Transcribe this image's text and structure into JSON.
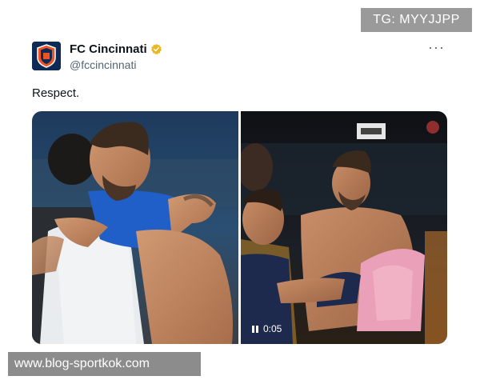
{
  "overlay": {
    "tg_label": "TG: MYYJJPP",
    "watermark": "www.blog-sportkok.com"
  },
  "tweet": {
    "display_name": "FC Cincinnati",
    "handle": "@fccincinnati",
    "text": "Respect.",
    "more_label": "···",
    "verified_icon": "verified-badge-icon",
    "verified_color": "#e8b923"
  },
  "media": {
    "video_duration": "0:05",
    "left_photo_alt": "Player hugging another player",
    "right_photo_alt": "Shirtless player with boy holding shirt"
  },
  "colors": {
    "brand_navy": "#0d2a55",
    "brand_orange": "#f05323"
  }
}
